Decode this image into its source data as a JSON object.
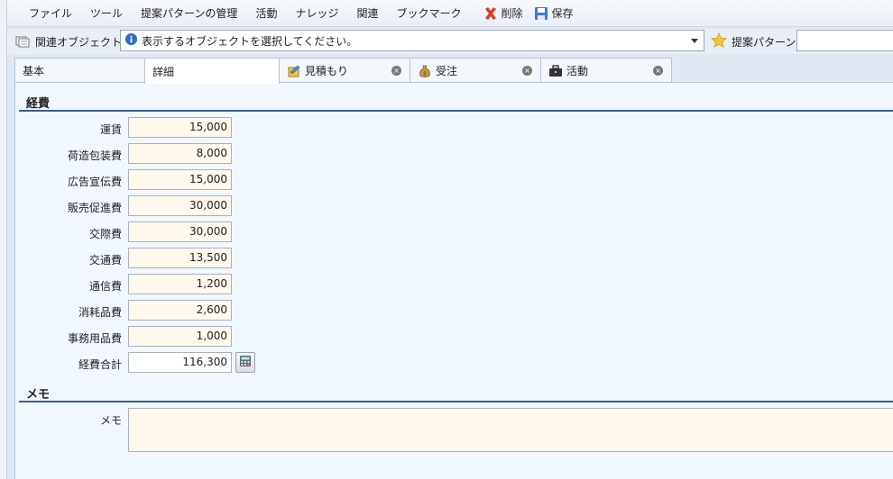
{
  "menu": {
    "items": [
      "ファイル",
      "ツール",
      "提案パターンの管理",
      "活動",
      "ナレッジ",
      "関連",
      "ブックマーク"
    ],
    "delete_label": "削除",
    "save_label": "保存"
  },
  "object_bar": {
    "label": "関連オブジェクト",
    "combo_text": "表示するオブジェクトを選択してください。",
    "pattern_label": "提案パターン",
    "pattern_value": ""
  },
  "tabs": [
    {
      "label": "基本",
      "icon": "none",
      "closable": false
    },
    {
      "label": "詳細",
      "icon": "none",
      "closable": false,
      "active": true
    },
    {
      "label": "見積もり",
      "icon": "estimate-icon",
      "closable": true
    },
    {
      "label": "受注",
      "icon": "money-bag-icon",
      "closable": true
    },
    {
      "label": "活動",
      "icon": "briefcase-icon",
      "closable": true
    }
  ],
  "expenses": {
    "title": "経費",
    "fields": [
      {
        "label": "運賃",
        "value": "15,000"
      },
      {
        "label": "荷造包装費",
        "value": "8,000"
      },
      {
        "label": "広告宣伝費",
        "value": "15,000"
      },
      {
        "label": "販売促進費",
        "value": "30,000"
      },
      {
        "label": "交際費",
        "value": "30,000"
      },
      {
        "label": "交通費",
        "value": "13,500"
      },
      {
        "label": "通信費",
        "value": "1,200"
      },
      {
        "label": "消耗品費",
        "value": "2,600"
      },
      {
        "label": "事務用品費",
        "value": "1,000"
      }
    ],
    "total": {
      "label": "経費合計",
      "value": "116,300"
    }
  },
  "memo": {
    "title": "メモ",
    "field_label": "メモ",
    "value": ""
  },
  "colors": {
    "section_line": "#3a5d8f",
    "input_bg": "#fff8ec",
    "content_bg": "#f1f7fe"
  }
}
